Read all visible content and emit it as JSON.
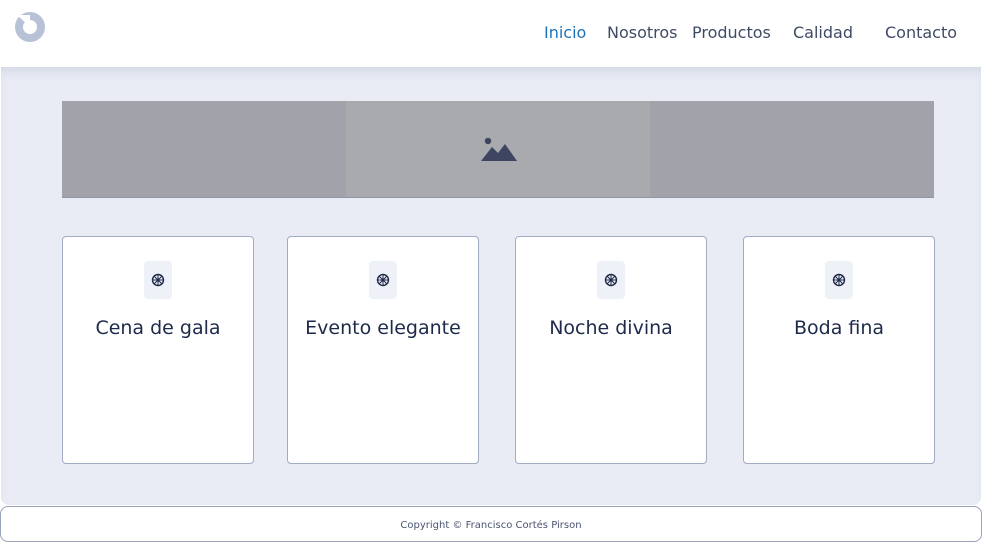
{
  "header": {
    "logo_icon": "ring-logo-icon",
    "nav": [
      {
        "label": "Inicio",
        "active": true
      },
      {
        "label": "Nosotros",
        "active": false
      },
      {
        "label": "Productos",
        "active": false
      },
      {
        "label": "Calidad",
        "active": false
      },
      {
        "label": "Contacto",
        "active": false
      }
    ]
  },
  "banner": {
    "icon": "image-placeholder-icon"
  },
  "cards": [
    {
      "title": "Cena de gala",
      "icon": "dharma-wheel-icon"
    },
    {
      "title": "Evento elegante",
      "icon": "dharma-wheel-icon"
    },
    {
      "title": "Noche divina",
      "icon": "dharma-wheel-icon"
    },
    {
      "title": "Boda fina",
      "icon": "dharma-wheel-icon"
    }
  ],
  "footer": {
    "copyright": "Copyright © Francisco Cortés Pirson"
  },
  "colors": {
    "accent": "#1f73b7",
    "background": "#e9ecf5",
    "text": "#1e2a4a"
  }
}
